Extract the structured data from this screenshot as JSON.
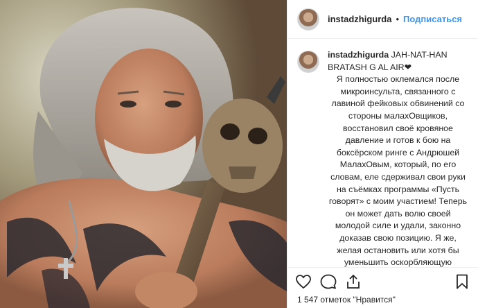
{
  "post": {
    "username": "instadzhigurda",
    "separator": "•",
    "follow_label": "Подписаться",
    "caption_first": "JAH-NAT-HAN BRATASH G AL AIR❤",
    "caption_body": "Я полностью оклемался после микроинсульта, связанного с лавиной фейковых обвинений со стороны малахОвщиков, восстановил своё кровяное давление и готов к бою на боксёрском ринге с Андрюшей МалахОвым, который, по его словам, еле сдерживал свои руки на съёмках программы «Пусть говорят» с моим участием! Теперь он может дать волю своей молодой силе и удали, законно доказав свою позицию. Я же, желая остановить или хотя бы уменьшить оскорбляющую нормальных людей малахОвщину, в международный праздник Уолловина вызываю",
    "likes_text": "1 547 отметок \"Нравится\""
  },
  "icons": {
    "like": "heart-icon",
    "comment": "comment-icon",
    "share": "share-icon",
    "save": "bookmark-icon"
  }
}
